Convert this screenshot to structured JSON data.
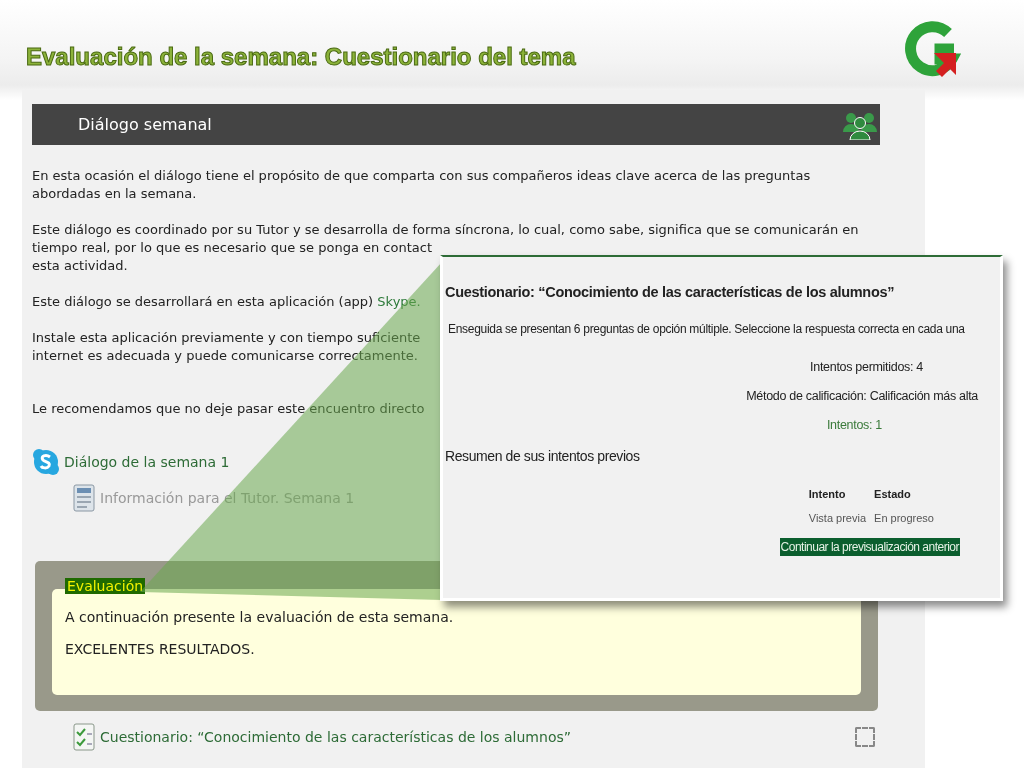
{
  "slide": {
    "title": "Evaluación de la semana: Cuestionario del tema"
  },
  "section": {
    "title": "Diálogo semanal",
    "paragraphs": [
      {
        "lines": [
          {
            "text": "En esta ocasión el diálogo tiene el propósito de que comparta con sus compañeros ideas clave acerca de las preguntas"
          },
          {
            "text": "abordadas en la semana."
          }
        ]
      },
      {
        "lines": [
          {
            "text": "Este diálogo es coordinado por su Tutor y se desarrolla de forma síncrona, lo cual, como sabe, significa que se comunicarán en"
          },
          {
            "text": "tiempo real, por lo que es necesario que se ponga en contact"
          },
          {
            "text": "esta actividad."
          }
        ]
      },
      {
        "lines": [
          {
            "text": "Este diálogo se desarrollará en esta aplicación (app) ",
            "link": "Skype."
          }
        ]
      },
      {
        "lines": [
          {
            "text": "Instale esta aplicación previamente y con tiempo suficiente"
          },
          {
            "text": "internet es adecuada y puede comunicarse correctamente."
          }
        ]
      },
      {
        "lines": [
          {
            "text": "Le recomendamos que no deje pasar este encuentro directo"
          }
        ]
      }
    ],
    "activities": [
      {
        "kind": "skype",
        "label": "Diálogo de la semana 1",
        "disabled": false
      },
      {
        "kind": "document",
        "label": "Información para el Tutor. Semana 1",
        "disabled": true
      }
    ]
  },
  "evaluation": {
    "label": "Evaluación",
    "lines": [
      "A continuación presente la evaluación de esta semana.",
      "EXCELENTES RESULTADOS."
    ],
    "activity": {
      "kind": "quiz",
      "label": "Cuestionario: “Conocimiento de las características de los alumnos”",
      "disabled": false
    }
  },
  "popup": {
    "title": "Cuestionario: “Conocimiento de las características de los alumnos”",
    "intro": "Enseguida se presentan 6 preguntas de opción múltiple. Seleccione la respuesta correcta en cada una",
    "info": [
      {
        "text": "Intentos permitidos: 4",
        "kind": "plain"
      },
      {
        "text": "Método de calificación: Calificación más alta",
        "kind": "plain"
      },
      {
        "text": "Intentos: 1",
        "kind": "link"
      }
    ],
    "summary_heading": "Resumen de sus intentos previos",
    "table": {
      "columns": [
        "Intento",
        "Estado"
      ],
      "rows": [
        [
          "Vista previa",
          "En progreso"
        ]
      ]
    },
    "button": "Continuar la previsualización anterior"
  }
}
